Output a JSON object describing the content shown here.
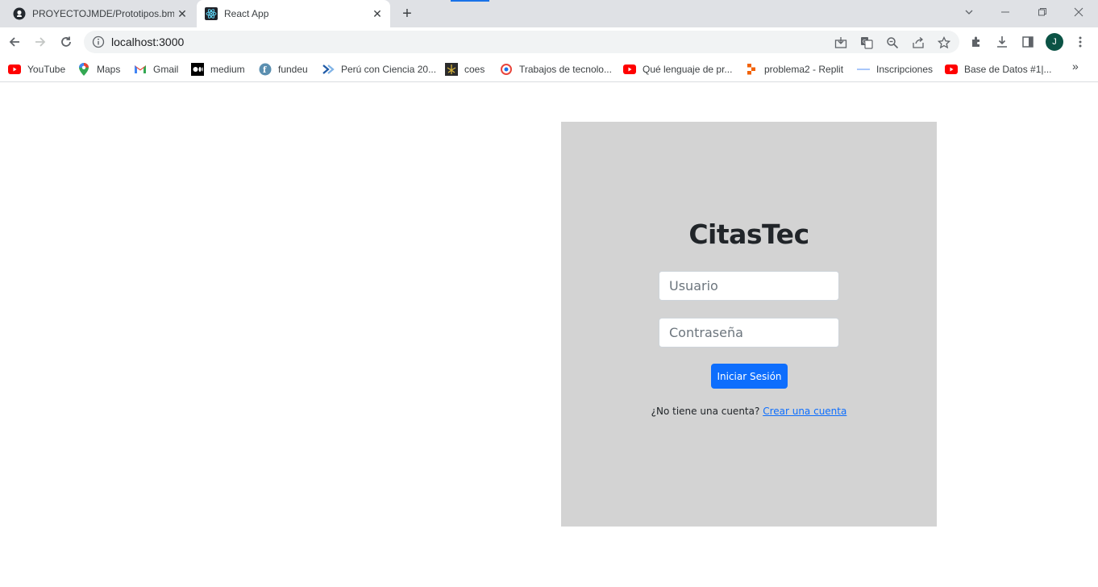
{
  "browser": {
    "tabs": [
      {
        "title": "PROYECTOJMDE/Prototipos.bmp",
        "active": false,
        "icon": "github-icon"
      },
      {
        "title": "React App",
        "active": true,
        "icon": "react-icon"
      }
    ],
    "new_tab_label": "+",
    "url": "localhost:3000",
    "profile_initial": "J",
    "bookmarks": [
      {
        "label": "YouTube",
        "icon": "youtube-icon",
        "color": "#ff0000"
      },
      {
        "label": "Maps",
        "icon": "maps-icon",
        "color": "#34a853"
      },
      {
        "label": "Gmail",
        "icon": "gmail-icon",
        "color": "#ea4335"
      },
      {
        "label": "medium",
        "icon": "medium-icon",
        "color": "#000000"
      },
      {
        "label": "fundeu",
        "icon": "fundeu-icon",
        "color": "#5b8fb0"
      },
      {
        "label": "Perú con Ciencia 20...",
        "icon": "peru-ciencia-icon",
        "color": "#1f5aa6"
      },
      {
        "label": "coes",
        "icon": "coes-icon",
        "color": "#333333"
      },
      {
        "label": "Trabajos de tecnolo...",
        "icon": "trabajos-icon",
        "color": "#e8453c"
      },
      {
        "label": "Qué lenguaje de pr...",
        "icon": "youtube-icon",
        "color": "#ff0000"
      },
      {
        "label": "problema2 - Replit",
        "icon": "replit-icon",
        "color": "#f26207"
      },
      {
        "label": "Inscripciones",
        "icon": "inscripciones-icon",
        "color": "#8ab4f8"
      },
      {
        "label": "Base de Datos #1|...",
        "icon": "youtube-icon",
        "color": "#ff0000"
      }
    ]
  },
  "login": {
    "title": "CitasTec",
    "username_placeholder": "Usuario",
    "password_placeholder": "Contraseña",
    "submit_label": "Iniciar Sesión",
    "signup_prompt": "¿No tiene una cuenta?",
    "signup_link": "Crear una cuenta"
  },
  "colors": {
    "panel_bg": "#d3d3d3",
    "primary": "#0d6efd",
    "tabstrip_bg": "#dfe1e5"
  }
}
